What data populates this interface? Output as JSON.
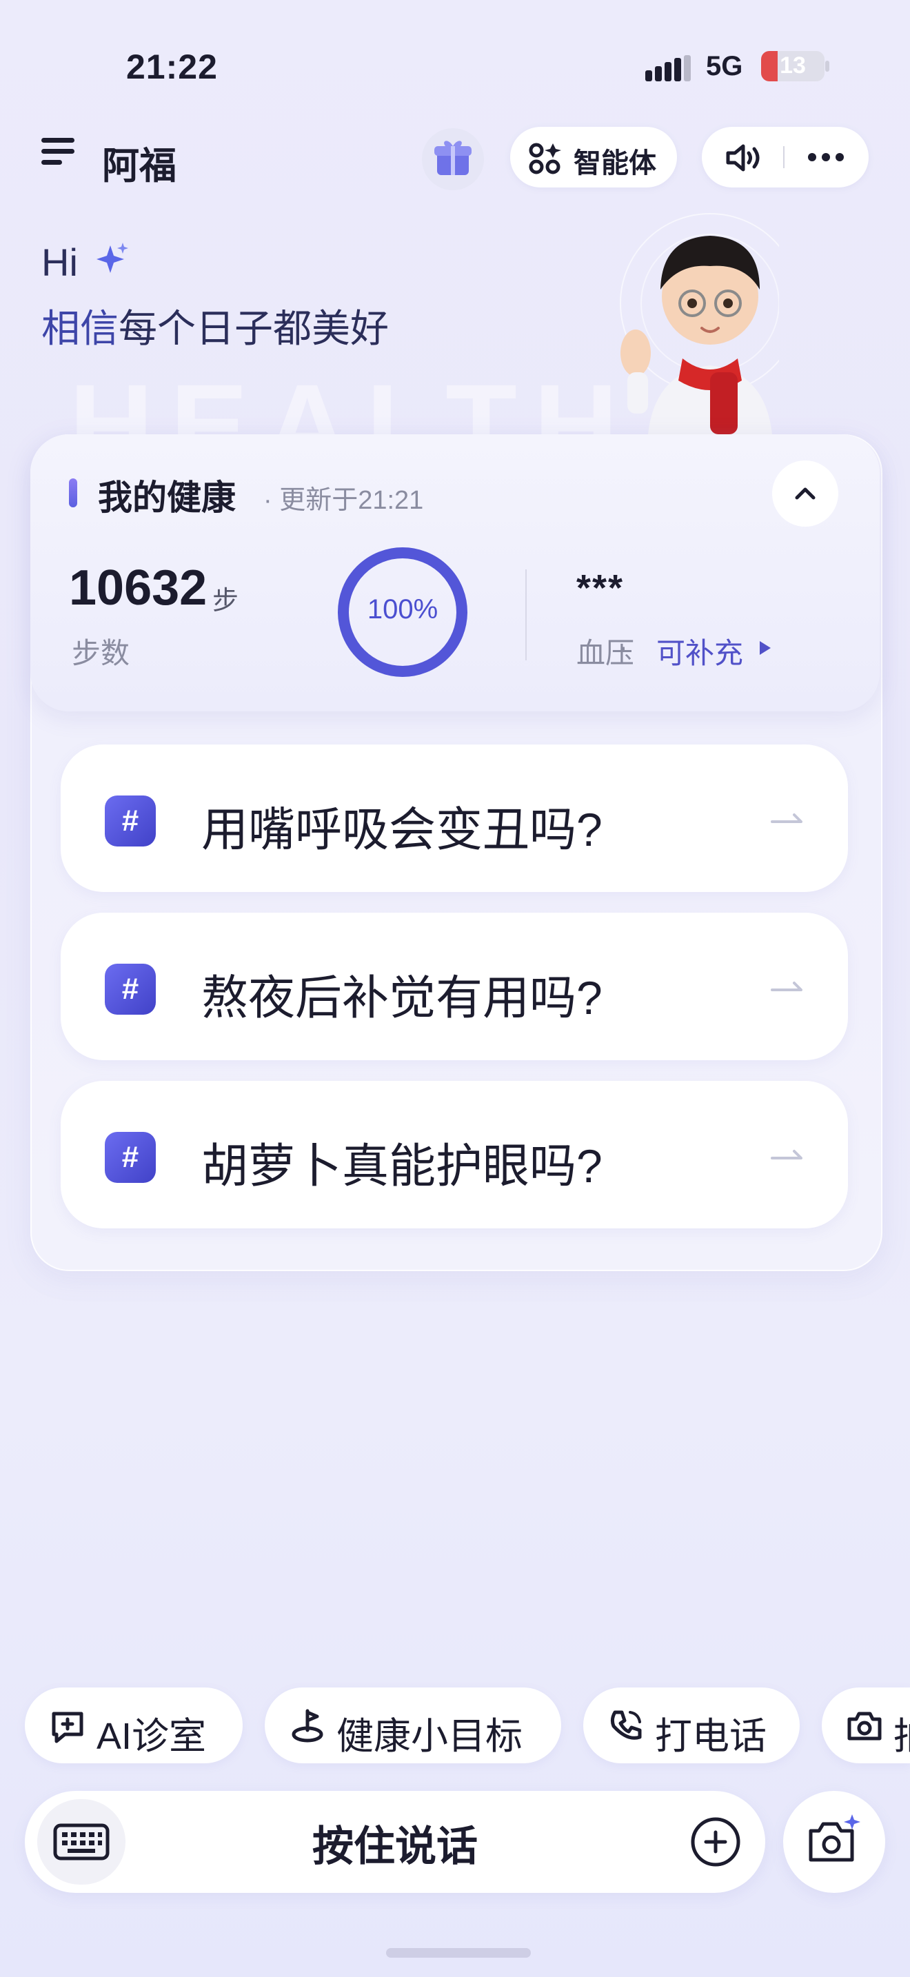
{
  "status_bar": {
    "time": "21:22",
    "network": "5G",
    "battery": "13"
  },
  "header": {
    "title": "阿福",
    "gift_icon": "gift-icon",
    "agent_label": "智能体",
    "sound_icon": "speaker-icon",
    "more_icon": "more-icon"
  },
  "greeting": {
    "hi": "Hi",
    "highlight": "相信",
    "rest": "每个日子都美好",
    "watermark": "HEALTH"
  },
  "health": {
    "title": "我的健康",
    "update": "· 更新于21:21",
    "steps_value": "10632",
    "steps_unit": "步",
    "steps_label": "步数",
    "progress_text": "100%",
    "progress": 1.0,
    "bp_value": "***",
    "bp_label": "血压",
    "bp_dot": "·",
    "bp_action": "可补充"
  },
  "questions": [
    {
      "hash": "#",
      "text": "用嘴呼吸会变丑吗?"
    },
    {
      "hash": "#",
      "text": "熬夜后补觉有用吗?"
    },
    {
      "hash": "#",
      "text": "胡萝卜真能护眼吗?"
    }
  ],
  "chips": [
    {
      "icon": "chat-plus-icon",
      "label": "AI诊室"
    },
    {
      "icon": "target-icon",
      "label": "健康小目标"
    },
    {
      "icon": "phone-icon",
      "label": "打电话"
    },
    {
      "icon": "camera-icon",
      "label": "拍"
    }
  ],
  "input": {
    "hold_to_talk": "按住说话",
    "keyboard_icon": "keyboard-icon",
    "plus_icon": "plus-icon",
    "camera_icon": "camera-sparkle-icon"
  },
  "colors": {
    "accent": "#5151c8",
    "ring": "#5356d8",
    "hash_badge": "#4f50d6"
  }
}
